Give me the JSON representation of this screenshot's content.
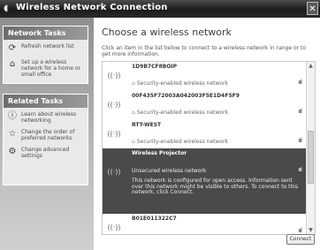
{
  "window": {
    "title": "Wireless Network Connection",
    "close_label": "✕"
  },
  "sidebar": {
    "network_tasks": {
      "header": "Network Tasks",
      "items": [
        {
          "label": "Refresh network list",
          "icon": "refresh-icon"
        },
        {
          "label": "Set up a wireless network for a home or small office",
          "icon": "setup-wireless-icon"
        }
      ]
    },
    "related_tasks": {
      "header": "Related Tasks",
      "items": [
        {
          "label": "Learn about wireless networking",
          "icon": "info-icon"
        },
        {
          "label": "Change the order of preferred networks",
          "icon": "star-icon"
        },
        {
          "label": "Change advanced settings",
          "icon": "settings-icon"
        }
      ]
    }
  },
  "main": {
    "heading": "Choose a wireless network",
    "instruction": "Click an item in the list below to connect to a wireless network in range or to get more information.",
    "networks": [
      {
        "name": "1D9B7CF8BOIP",
        "security": "Security-enabled wireless network",
        "signal": "ıııl"
      },
      {
        "name": "00F435F72003A042003F5E1D4F5F9",
        "security": "Security-enabled wireless network",
        "signal": "ıııl"
      },
      {
        "name": "RTT-WEST",
        "security": "Security-enabled wireless network",
        "signal": "ıııl"
      },
      {
        "name": "Wireless Projector",
        "security": "Unsecured wireless network",
        "signal": "ıııl",
        "description": "This network is configured for open access. Information sent over this network might be visible to others. To connect to this network, click Connect."
      },
      {
        "name": "B01E011322C7",
        "security": "",
        "signal": "ıııl"
      }
    ],
    "connect_label": "Connect"
  }
}
